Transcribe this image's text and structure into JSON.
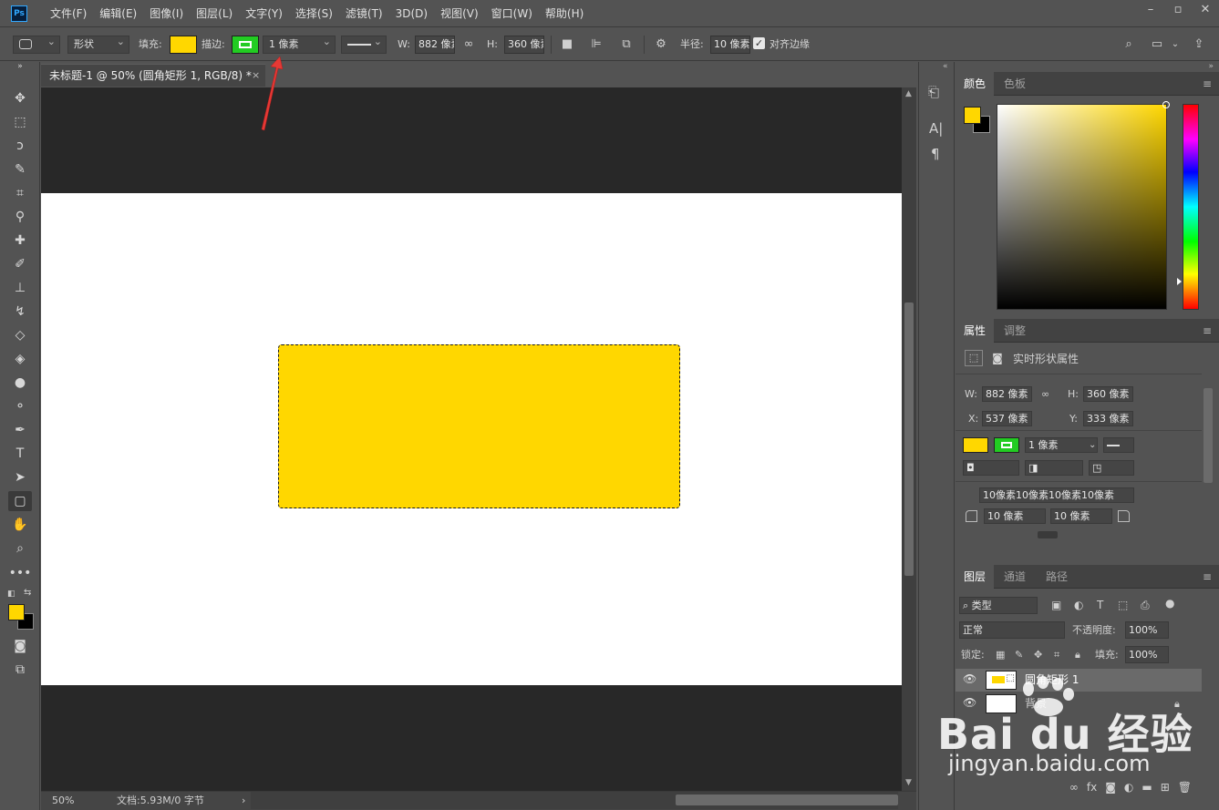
{
  "app": {
    "logo": "Ps"
  },
  "menu": [
    "文件(F)",
    "编辑(E)",
    "图像(I)",
    "图层(L)",
    "文字(Y)",
    "选择(S)",
    "滤镜(T)",
    "3D(D)",
    "视图(V)",
    "窗口(W)",
    "帮助(H)"
  ],
  "options": {
    "mode": "形状",
    "fill_label": "填充:",
    "stroke_label": "描边:",
    "stroke_width": "1 像素",
    "w_label": "W:",
    "w_value": "882 像素",
    "h_label": "H:",
    "h_value": "360 像素",
    "radius_label": "半径:",
    "radius_value": "10 像素",
    "align_edges": "对齐边缘",
    "align_checked": true
  },
  "colors": {
    "fill": "#ffd700",
    "stroke": "#22cc22",
    "foreground": "#ffd700",
    "background": "#000000",
    "accent": "#e53935"
  },
  "document": {
    "tab_title": "未标题-1 @ 50% (圆角矩形 1, RGB/8) *",
    "close": "×"
  },
  "status": {
    "zoom": "50%",
    "doc_info": "文档:5.93M/0 字节",
    "arrow": "›"
  },
  "color_panel": {
    "tabs": [
      "颜色",
      "色板"
    ]
  },
  "properties_panel": {
    "tabs": [
      "属性",
      "调整"
    ],
    "title": "实时形状属性",
    "w_label": "W:",
    "w": "882 像素",
    "h_label": "H:",
    "h": "360 像素",
    "x_label": "X:",
    "x": "537 像素",
    "y_label": "Y:",
    "y": "333 像素",
    "stroke_width": "1 像素",
    "corners_all": "10像素10像素10像素10像素",
    "corner_tl": "10 像素",
    "corner_tr": "10 像素"
  },
  "layers_panel": {
    "tabs": [
      "图层",
      "通道",
      "路径"
    ],
    "filter": "类型",
    "blend": "正常",
    "opacity_label": "不透明度:",
    "opacity": "100%",
    "lock_label": "锁定:",
    "fill_label": "填充:",
    "fill": "100%",
    "layers": [
      {
        "name": "圆角矩形 1",
        "selected": true
      },
      {
        "name": "背景",
        "selected": false,
        "locked": true
      }
    ]
  },
  "watermark": {
    "brand": "Bai du 经验",
    "url": "jingyan.baidu.com"
  }
}
